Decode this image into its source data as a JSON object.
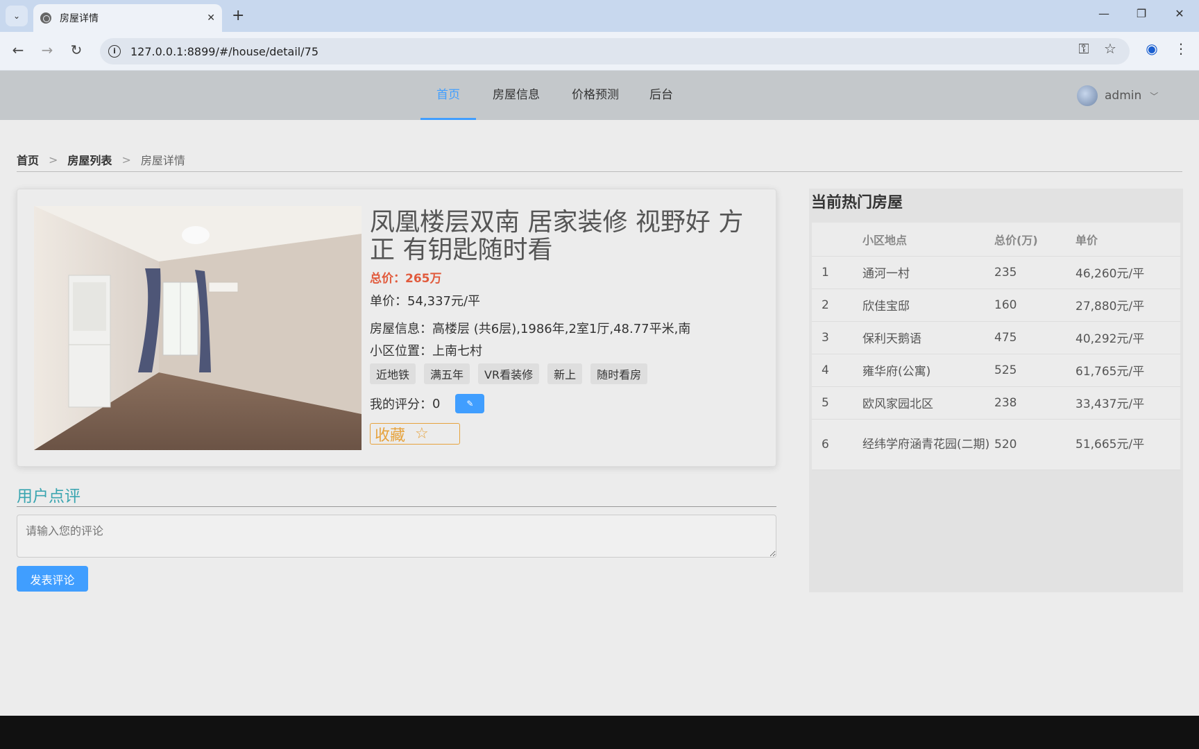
{
  "browser": {
    "tab_title": "房屋详情",
    "url": "127.0.0.1:8899/#/house/detail/75"
  },
  "nav": {
    "items": [
      {
        "label": "首页",
        "active": true
      },
      {
        "label": "房屋信息",
        "active": false
      },
      {
        "label": "价格预测",
        "active": false
      },
      {
        "label": "后台",
        "active": false
      }
    ],
    "username": "admin"
  },
  "breadcrumb": {
    "home": "首页",
    "list": "房屋列表",
    "current": "房屋详情",
    "separator": ">"
  },
  "house": {
    "title": "凤凰楼层双南 居家装修 视野好 方正 有钥匙随时看",
    "total_price": "总价：265万",
    "unit_price": "单价：54,337元/平",
    "info": "房屋信息：高楼层 (共6层),1986年,2室1厅,48.77平米,南",
    "location": "小区位置：上南七村",
    "tags": [
      "近地铁",
      "满五年",
      "VR看装修",
      "新上",
      "随时看房"
    ],
    "rating_label": "我的评分：",
    "rating_value": "0",
    "favorite_label": "收藏"
  },
  "comments": {
    "title": "用户点评",
    "placeholder": "请输入您的评论",
    "submit_label": "发表评论"
  },
  "hot": {
    "title": "当前热门房屋",
    "columns": [
      "",
      "小区地点",
      "总价(万)",
      "单价"
    ],
    "rows": [
      {
        "rank": "1",
        "name": "通河一村",
        "total": "235",
        "unit": "46,260元/平"
      },
      {
        "rank": "2",
        "name": "欣佳宝邸",
        "total": "160",
        "unit": "27,880元/平"
      },
      {
        "rank": "3",
        "name": "保利天鹅语",
        "total": "475",
        "unit": "40,292元/平"
      },
      {
        "rank": "4",
        "name": "雍华府(公寓)",
        "total": "525",
        "unit": "61,765元/平"
      },
      {
        "rank": "5",
        "name": "欧风家园北区",
        "total": "238",
        "unit": "33,437元/平"
      },
      {
        "rank": "6",
        "name": "经纬学府涵青花园(二期)",
        "total": "520",
        "unit": "51,665元/平"
      }
    ]
  },
  "colors": {
    "accent": "#409eff",
    "price": "#e15a3c",
    "favorite": "#e6a23c",
    "comment_title": "#3aa5b0"
  }
}
